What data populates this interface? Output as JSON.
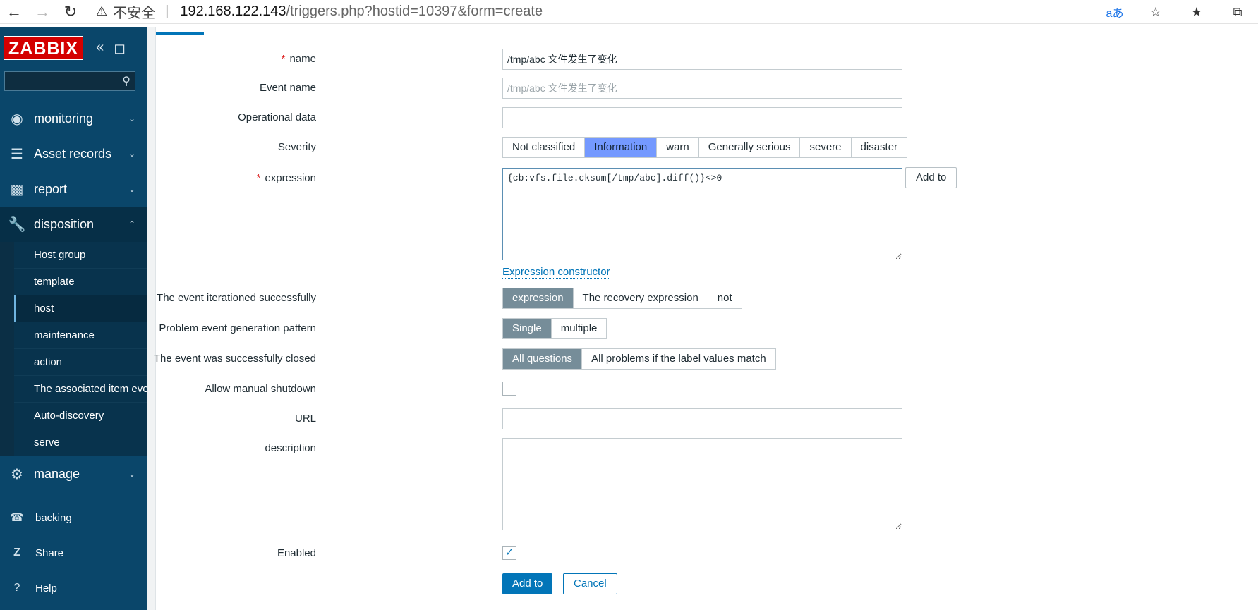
{
  "browser": {
    "insecure_label": "不安全",
    "url_host": "192.168.122.143",
    "url_path": "/triggers.php?hostid=10397&form=create",
    "read_aloud_label": "aあ"
  },
  "sidebar": {
    "logo": "ZABBIX",
    "search_placeholder": "",
    "menu": [
      {
        "label": "monitoring",
        "icon": "eye-icon"
      },
      {
        "label": "Asset records",
        "icon": "list-icon"
      },
      {
        "label": "report",
        "icon": "bar-chart-icon"
      },
      {
        "label": "disposition",
        "icon": "wrench-icon"
      },
      {
        "label": "manage",
        "icon": "gear-icon"
      }
    ],
    "submenu": [
      "Host group",
      "template",
      "host",
      "maintenance",
      "action",
      "The associated item event",
      "Auto-discovery",
      "serve"
    ],
    "bottom": [
      {
        "label": "backing",
        "icon": "headset-icon"
      },
      {
        "label": "Share",
        "icon": "share-icon"
      },
      {
        "label": "Help",
        "icon": "help-icon"
      }
    ]
  },
  "form": {
    "name_label": "name",
    "name_value": "/tmp/abc 文件发生了变化",
    "event_name_label": "Event name",
    "event_name_placeholder": "/tmp/abc 文件发生了变化",
    "operational_data_label": "Operational data",
    "severity_label": "Severity",
    "severity_options": [
      "Not classified",
      "Information",
      "warn",
      "Generally serious",
      "severe",
      "disaster"
    ],
    "expression_label": "expression",
    "expression_value": "{cb:vfs.file.cksum[/tmp/abc].diff()}<>0",
    "add_to_label": "Add to",
    "expression_constructor": "Expression constructor",
    "iterationed_label": "The event iterationed successfully",
    "iterationed_options": [
      "expression",
      "The recovery expression",
      "not"
    ],
    "pattern_label": "Problem event generation pattern",
    "pattern_options": [
      "Single",
      "multiple"
    ],
    "closed_label": "The event was successfully closed",
    "closed_options": [
      "All questions",
      "All problems if the label values match"
    ],
    "manual_shutdown_label": "Allow manual shutdown",
    "url_label": "URL",
    "description_label": "description",
    "enabled_label": "Enabled",
    "submit_label": "Add to",
    "cancel_label": "Cancel"
  }
}
